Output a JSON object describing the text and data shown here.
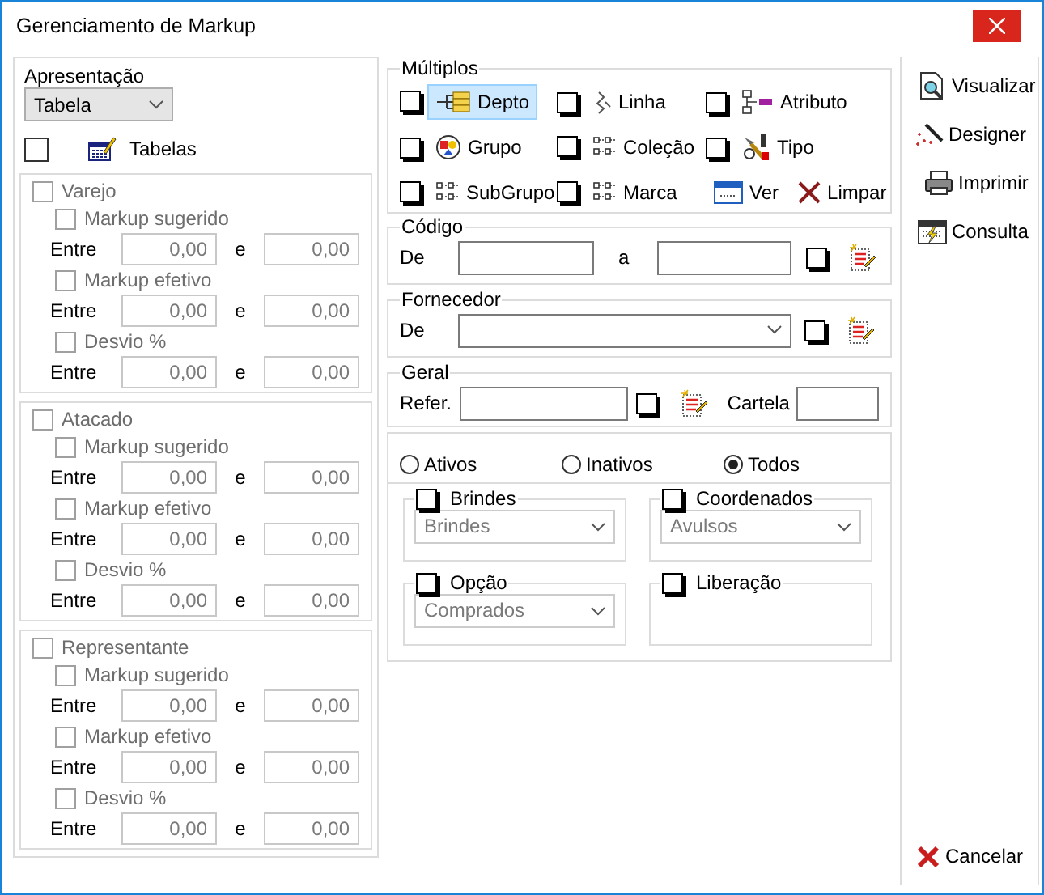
{
  "window": {
    "title": "Gerenciamento de Markup"
  },
  "presentation": {
    "label": "Apresentação",
    "value": "Tabela",
    "tables": {
      "label": "Tabelas",
      "checked": false
    }
  },
  "groups": [
    {
      "label": "Varejo",
      "checked": false,
      "disabled": true,
      "criteria": [
        {
          "label": "Markup sugerido",
          "checked": false,
          "from_label": "Entre",
          "from": "0,00",
          "to_label": "e",
          "to": "0,00"
        },
        {
          "label": "Markup efetivo",
          "checked": false,
          "from_label": "Entre",
          "from": "0,00",
          "to_label": "e",
          "to": "0,00"
        },
        {
          "label": "Desvio %",
          "checked": false,
          "from_label": "Entre",
          "from": "0,00",
          "to_label": "e",
          "to": "0,00"
        }
      ]
    },
    {
      "label": "Atacado",
      "checked": false,
      "disabled": true,
      "criteria": [
        {
          "label": "Markup sugerido",
          "checked": false,
          "from_label": "Entre",
          "from": "0,00",
          "to_label": "e",
          "to": "0,00"
        },
        {
          "label": "Markup efetivo",
          "checked": false,
          "from_label": "Entre",
          "from": "0,00",
          "to_label": "e",
          "to": "0,00"
        },
        {
          "label": "Desvio %",
          "checked": false,
          "from_label": "Entre",
          "from": "0,00",
          "to_label": "e",
          "to": "0,00"
        }
      ]
    },
    {
      "label": "Representante",
      "checked": false,
      "disabled": true,
      "criteria": [
        {
          "label": "Markup sugerido",
          "checked": false,
          "from_label": "Entre",
          "from": "0,00",
          "to_label": "e",
          "to": "0,00"
        },
        {
          "label": "Markup efetivo",
          "checked": false,
          "from_label": "Entre",
          "from": "0,00",
          "to_label": "e",
          "to": "0,00"
        },
        {
          "label": "Desvio %",
          "checked": false,
          "from_label": "Entre",
          "from": "0,00",
          "to_label": "e",
          "to": "0,00"
        }
      ]
    }
  ],
  "multiples": {
    "title": "Múltiplos",
    "items": [
      {
        "kind": "check",
        "label": "Depto",
        "checked": false,
        "selected": true
      },
      {
        "kind": "check",
        "label": "Linha",
        "checked": false,
        "selected": false
      },
      {
        "kind": "check",
        "label": "Atributo",
        "checked": false,
        "selected": false
      },
      {
        "kind": "check",
        "label": "Grupo",
        "checked": false,
        "selected": false
      },
      {
        "kind": "check",
        "label": "Coleção",
        "checked": false,
        "selected": false
      },
      {
        "kind": "check",
        "label": "Tipo",
        "checked": false,
        "selected": false
      },
      {
        "kind": "check",
        "label": "SubGrupo",
        "checked": false,
        "selected": false
      },
      {
        "kind": "check",
        "label": "Marca",
        "checked": false,
        "selected": false
      },
      {
        "kind": "button",
        "label": "Ver"
      },
      {
        "kind": "button",
        "label": "Limpar"
      }
    ]
  },
  "code": {
    "title": "Código",
    "from_label": "De",
    "to_label": "a",
    "checked": false
  },
  "supplier": {
    "title": "Fornecedor",
    "from_label": "De",
    "checked": false
  },
  "general": {
    "title": "Geral",
    "ref_label": "Refer.",
    "checked": false,
    "card_label": "Cartela"
  },
  "status": [
    {
      "label": "Ativos",
      "selected": false
    },
    {
      "label": "Inativos",
      "selected": false
    },
    {
      "label": "Todos",
      "selected": true
    }
  ],
  "options": [
    {
      "kind": "select",
      "label": "Brindes",
      "checked": false,
      "value": "Brindes",
      "disabled": true
    },
    {
      "kind": "select",
      "label": "Coordenados",
      "checked": false,
      "value": "Avulsos",
      "disabled": true
    },
    {
      "kind": "select",
      "label": "Opção",
      "checked": false,
      "value": "Comprados",
      "disabled": true
    },
    {
      "kind": "empty",
      "label": "Liberação",
      "checked": false
    }
  ],
  "actions": [
    {
      "label": "Visualizar"
    },
    {
      "label": "Designer"
    },
    {
      "label": "Imprimir"
    },
    {
      "label": "Consulta"
    }
  ],
  "cancel": {
    "label": "Cancelar"
  }
}
